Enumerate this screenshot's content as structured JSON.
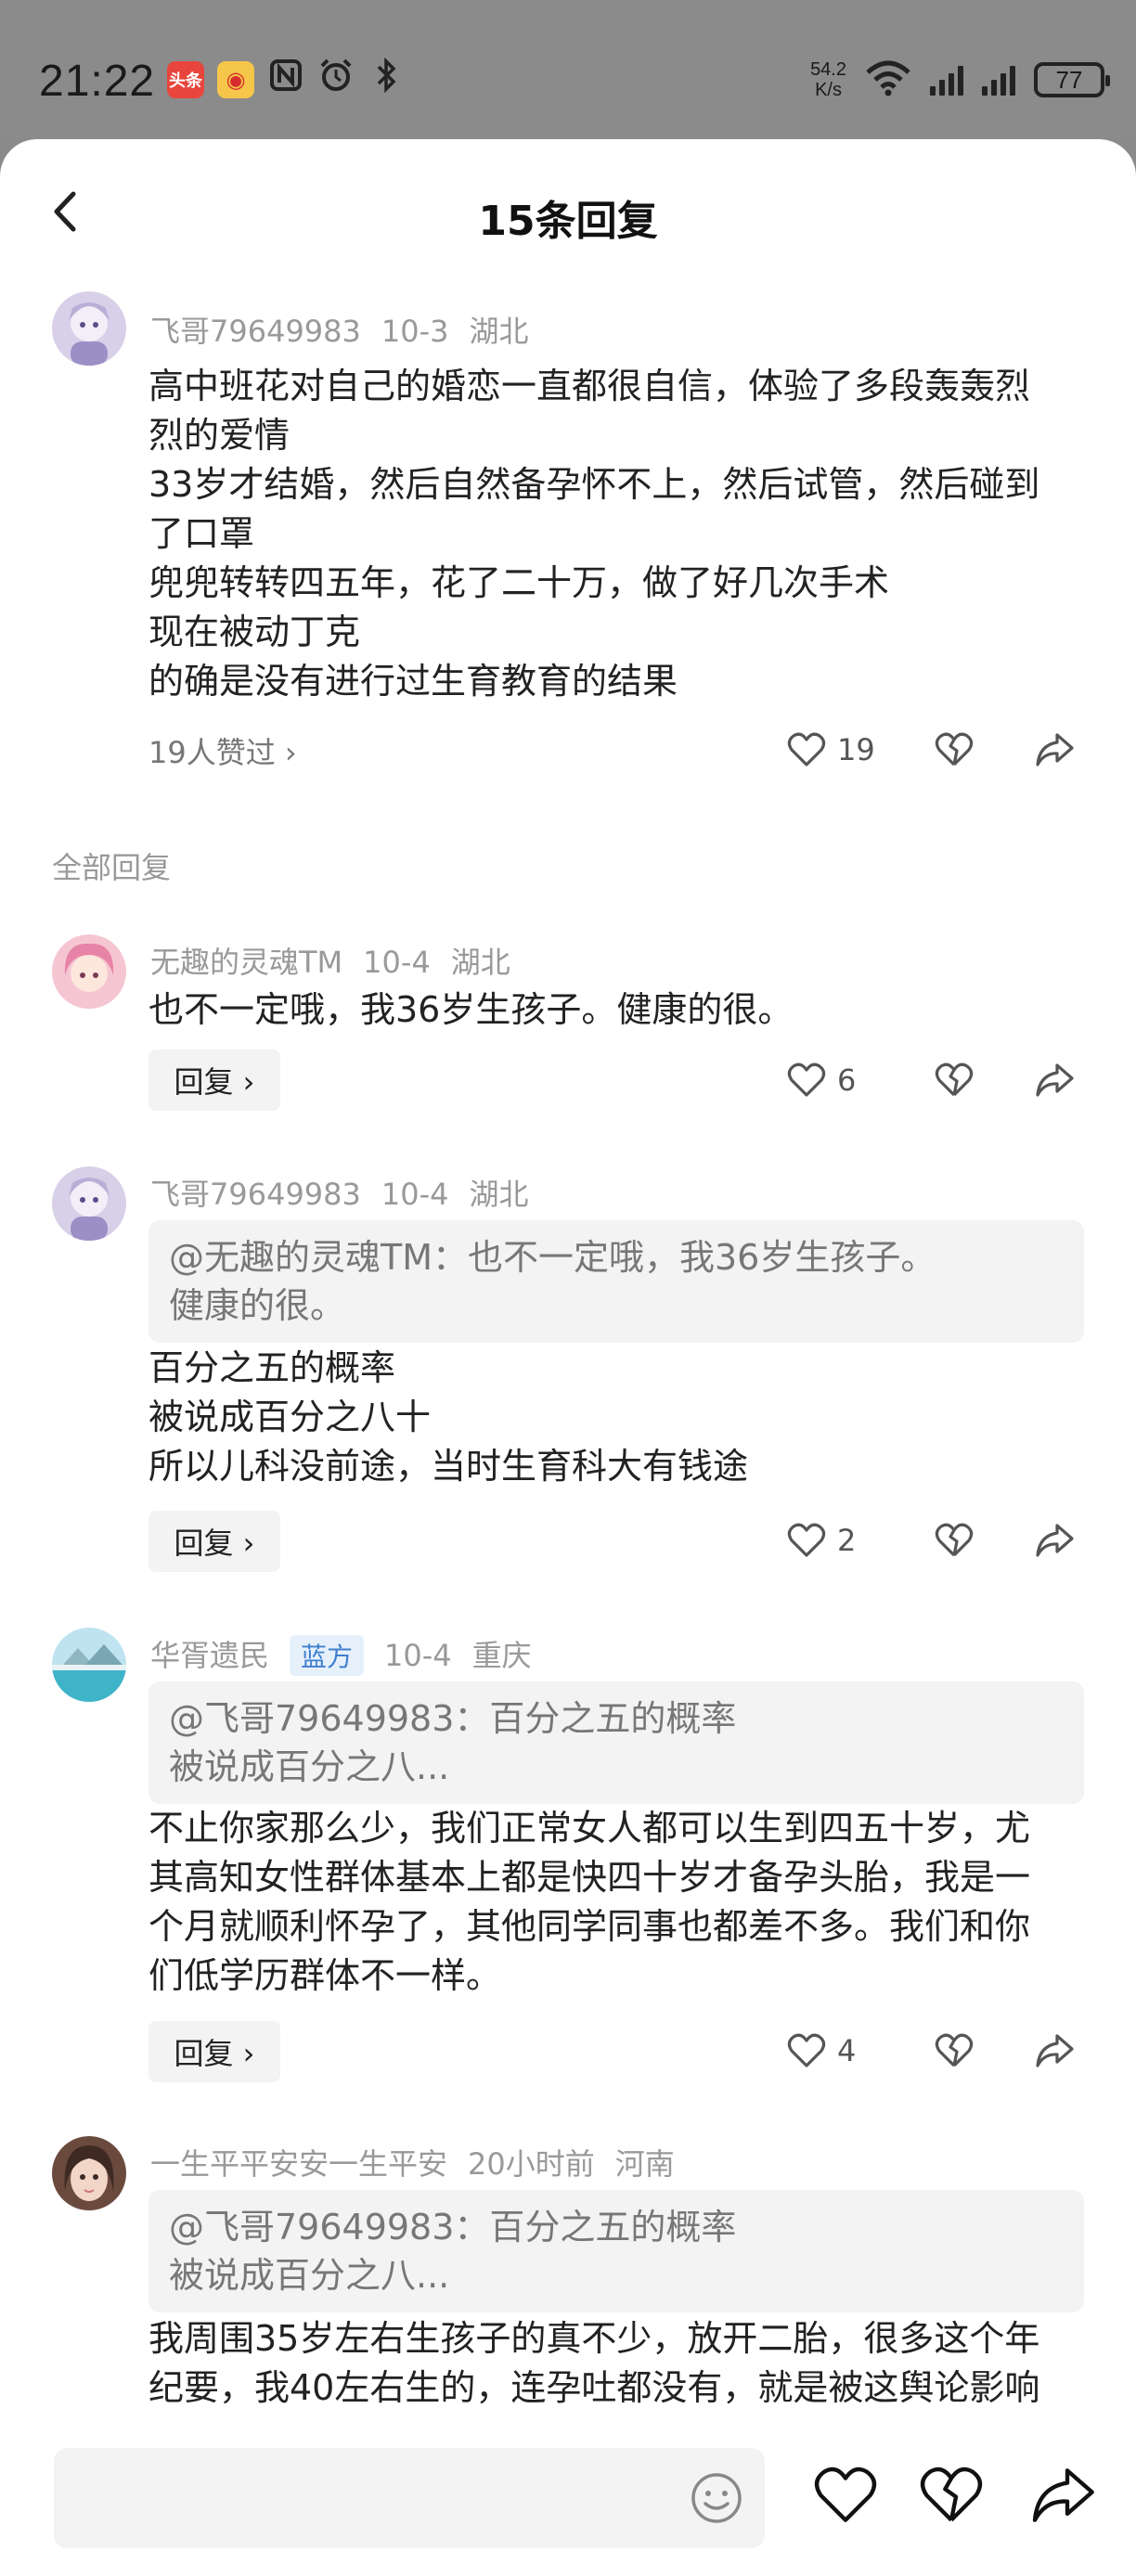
{
  "status_bar": {
    "time": "21:22",
    "app1_label": "头条",
    "speed_value": "54.2",
    "speed_unit": "K/s",
    "battery": "77"
  },
  "header": {
    "title": "15条回复"
  },
  "main_comment": {
    "user": "飞哥79649983",
    "date": "10-3",
    "location": "湖北",
    "lines": [
      "高中班花对自己的婚恋一直都很自信，体验了多段轰轰烈",
      "烈的爱情",
      "33岁才结婚，然后自然备孕怀不上，然后试管，然后碰到",
      "了口罩",
      "兜兜转转四五年，花了二十万，做了好几次手术",
      "现在被动丁克",
      "的确是没有进行过生育教育的结果"
    ],
    "likes_link": "19人赞过 ›",
    "like_count": "19"
  },
  "section_label": "全部回复",
  "replies": [
    {
      "user": "无趣的灵魂TM",
      "date": "10-4",
      "location": "湖北",
      "lines": [
        "也不一定哦，我36岁生孩子。健康的很。"
      ],
      "reply_label": "回复 ›",
      "like_count": "6"
    },
    {
      "user": "飞哥79649983",
      "date": "10-4",
      "location": "湖北",
      "quote_lines": [
        "@无趣的灵魂TM：也不一定哦，我36岁生孩子。",
        "健康的很。"
      ],
      "lines": [
        "百分之五的概率",
        "被说成百分之八十",
        "所以儿科没前途，当时生育科大有钱途"
      ],
      "reply_label": "回复 ›",
      "like_count": "2"
    },
    {
      "user": "华胥遗民",
      "badge": "蓝方",
      "date": "10-4",
      "location": "重庆",
      "quote_lines": [
        "@飞哥79649983：百分之五的概率",
        "被说成百分之八..."
      ],
      "lines": [
        "不止你家那么少，我们正常女人都可以生到四五十岁，尤",
        "其高知女性群体基本上都是快四十岁才备孕头胎，我是一",
        "个月就顺利怀孕了，其他同学同事也都差不多。我们和你",
        "们低学历群体不一样。"
      ],
      "reply_label": "回复 ›",
      "like_count": "4"
    },
    {
      "user": "一生平平安安一生平安",
      "date": "20小时前",
      "location": "河南",
      "quote_lines": [
        "@飞哥79649983：百分之五的概率",
        "被说成百分之八..."
      ],
      "lines": [
        "我周围35岁左右生孩子的真不少，放开二胎，很多这个年",
        "纪要，我40左右生的，连孕吐都没有，就是被这舆论影响"
      ]
    }
  ],
  "bottom_bar": {
    "input_placeholder": ""
  }
}
